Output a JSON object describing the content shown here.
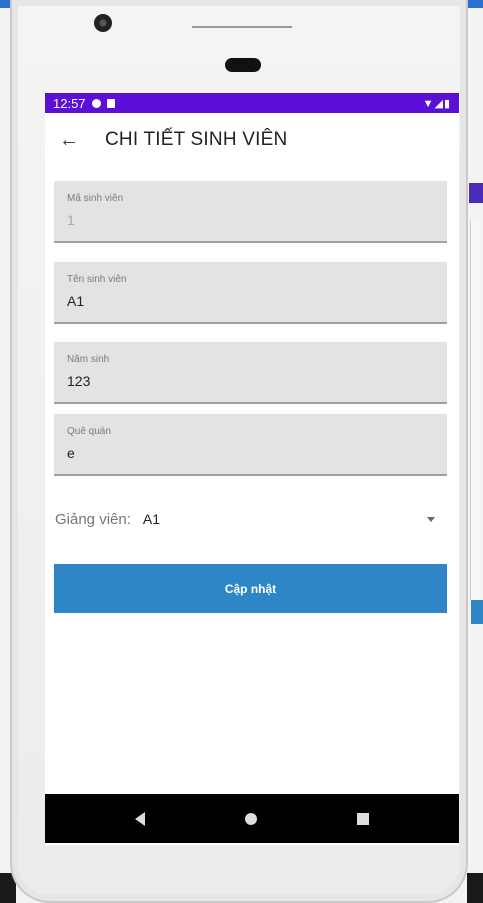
{
  "status_bar": {
    "time": "12:57",
    "right_icons": "▼◢▮"
  },
  "app_bar": {
    "title": "CHI TIẾT SINH VIÊN",
    "back_icon": "←"
  },
  "fields": [
    {
      "label": "Mã sinh viên",
      "value": "1",
      "disabled": true
    },
    {
      "label": "Tên sinh viên",
      "value": "A1"
    },
    {
      "label": "Năm sinh",
      "value": "123"
    },
    {
      "label": "Quê quán",
      "value": "e"
    }
  ],
  "lecturer": {
    "label": "Giảng viên:",
    "value": "A1"
  },
  "update_button": {
    "label": "Cập nhật",
    "color": "#2f86c6"
  },
  "colors": {
    "status_bar": "#5c0fd6",
    "field_bg": "#e3e3e3"
  }
}
